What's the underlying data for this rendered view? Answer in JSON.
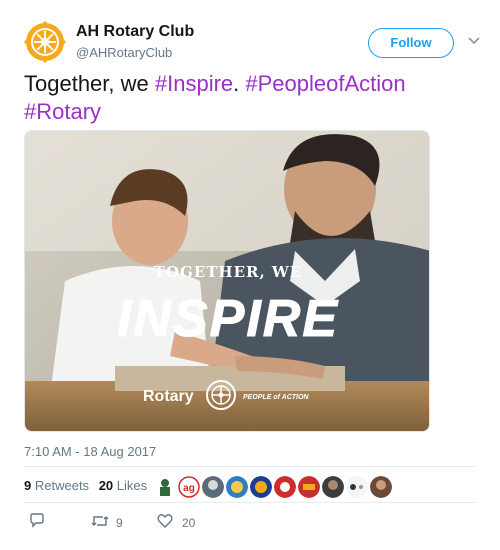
{
  "account": {
    "name": "AH Rotary Club",
    "handle": "@AHRotaryClub",
    "follow_label": "Follow"
  },
  "tweet": {
    "text_prefix": "Together, we ",
    "hashtags": [
      "#Inspire",
      "#PeopleofAction",
      "#Rotary"
    ],
    "separator": ". "
  },
  "media": {
    "overlay_line1": "TOGETHER, WE",
    "overlay_line2": "INSPIRE",
    "brand": "Rotary",
    "tagline": "PEOPLE of ACTION"
  },
  "timestamp": "7:10 AM - 18 Aug 2017",
  "stats": {
    "retweets_count": "9",
    "retweets_label": "Retweets",
    "likes_count": "20",
    "likes_label": "Likes"
  },
  "actions": {
    "retweet_count": "9",
    "like_count": "20"
  },
  "colors": {
    "accent": "#1da1f2",
    "hashtag": "#9b30c8",
    "rotary_gold": "#f7a81b"
  }
}
